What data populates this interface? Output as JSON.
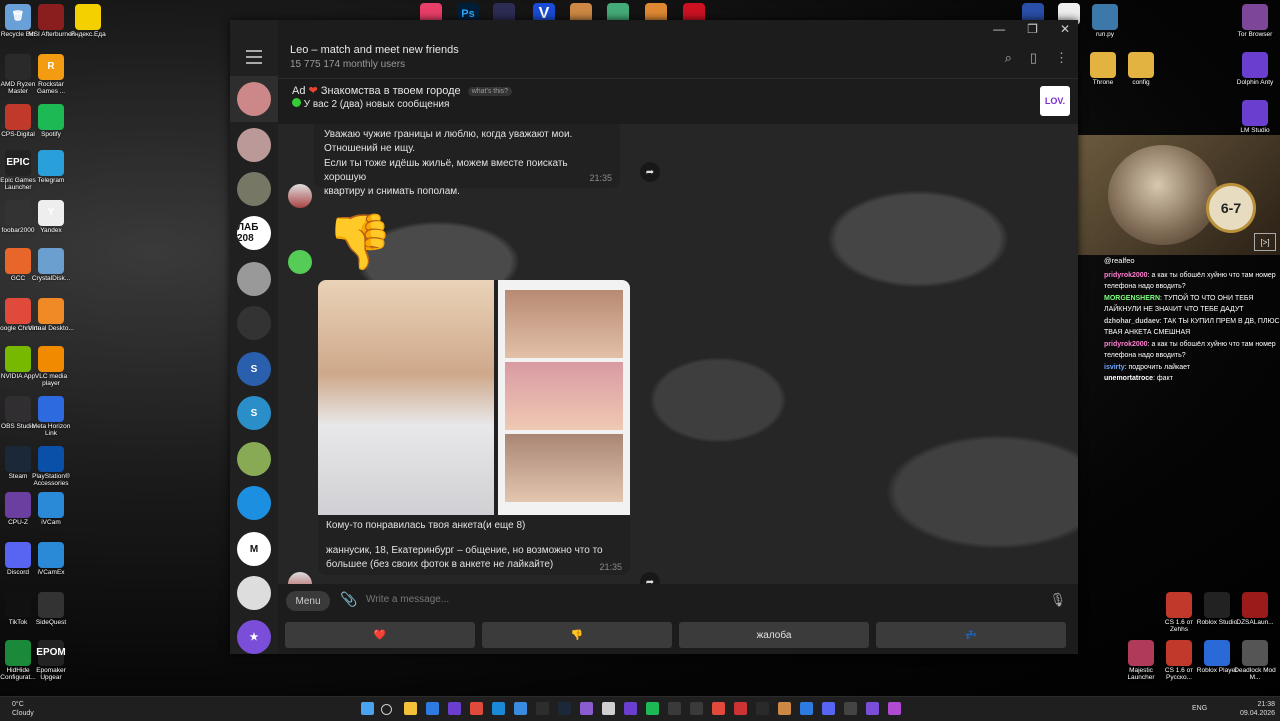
{
  "desktop": {
    "left_icons": [
      {
        "label": "Recycle Bin",
        "color": "#6aa0d8",
        "glyph": "🗑"
      },
      {
        "label": "MSI Afterburner",
        "color": "#8a1d1d",
        "glyph": ""
      },
      {
        "label": "Яндекс.Еда",
        "color": "#f5d000",
        "glyph": ""
      },
      {
        "label": "AMD Ryzen Master",
        "color": "#2a2a2a",
        "glyph": ""
      },
      {
        "label": "Rockstar Games ...",
        "color": "#f39c12",
        "glyph": "R"
      },
      {
        "label": "CPS-Digital",
        "color": "#c0392b",
        "glyph": ""
      },
      {
        "label": "Spotify",
        "color": "#1db954",
        "glyph": ""
      },
      {
        "label": "Epic Games Launcher",
        "color": "#222",
        "glyph": "EPIC"
      },
      {
        "label": "Telegram",
        "color": "#2aa0da",
        "glyph": ""
      },
      {
        "label": "foobar2000",
        "color": "#333",
        "glyph": ""
      },
      {
        "label": "Yandex",
        "color": "#eee",
        "glyph": "Y"
      },
      {
        "label": "GCC",
        "color": "#e8662a",
        "glyph": ""
      },
      {
        "label": "CrystalDisk...",
        "color": "#6a9fd0",
        "glyph": ""
      },
      {
        "label": "Google Chrome",
        "color": "#e04a3a",
        "glyph": ""
      },
      {
        "label": "Virtual Deskto...",
        "color": "#f08a24",
        "glyph": ""
      },
      {
        "label": "NVIDIA App",
        "color": "#76b900",
        "glyph": ""
      },
      {
        "label": "VLC media player",
        "color": "#f28a00",
        "glyph": ""
      },
      {
        "label": "OBS Studio",
        "color": "#302e31",
        "glyph": ""
      },
      {
        "label": "Meta Horizon Link",
        "color": "#2d6ae0",
        "glyph": ""
      },
      {
        "label": "Steam",
        "color": "#1b2838",
        "glyph": ""
      },
      {
        "label": "PlayStation® Accessories",
        "color": "#0a4fa8",
        "glyph": ""
      },
      {
        "label": "CPU-Z",
        "color": "#6b3fa0",
        "glyph": ""
      },
      {
        "label": "iVCam",
        "color": "#2a8ad8",
        "glyph": ""
      },
      {
        "label": "Discord",
        "color": "#5865f2",
        "glyph": ""
      },
      {
        "label": "iVCamEx",
        "color": "#2a8ad8",
        "glyph": ""
      },
      {
        "label": "TikTok",
        "color": "#111",
        "glyph": ""
      },
      {
        "label": "SideQuest",
        "color": "#333",
        "glyph": ""
      },
      {
        "label": "HidHide Configurat...",
        "color": "#1a8a3a",
        "glyph": ""
      },
      {
        "label": "Epomaker Upgear",
        "color": "#222",
        "glyph": "EPOM"
      }
    ],
    "right_icons": [
      {
        "label": "run.py",
        "color": "#3c78aa"
      },
      {
        "label": "Tor Browser",
        "color": "#7d4698"
      },
      {
        "label": "Throne",
        "color": "#e3b341"
      },
      {
        "label": "config",
        "color": "#e3b341"
      },
      {
        "label": "Dolphin Anty",
        "color": "#6a3fd0"
      },
      {
        "label": "LM Studio",
        "color": "#6a3fd0"
      },
      {
        "label": "CS 1.6 от Zehhs",
        "color": "#c0392b"
      },
      {
        "label": "Roblox Studio",
        "color": "#222"
      },
      {
        "label": "DZSALaun...",
        "color": "#9b1b1b"
      },
      {
        "label": "Majestic Launcher",
        "color": "#b03a5a"
      },
      {
        "label": "CS 1.6 от Русско...",
        "color": "#c0392b"
      },
      {
        "label": "Roblox Player",
        "color": "#2a6ad8"
      },
      {
        "label": "Deadlock Mod M...",
        "color": "#555"
      }
    ]
  },
  "telegram": {
    "bot_title": "Leo – match and meet new friends",
    "bot_subtitle": "15 775 174 monthly users",
    "ad": {
      "label": "Ad",
      "title": "Знакомства в твоем городе",
      "whats_this": "what's this?",
      "text": "У вас 2 (два) новых сообщения",
      "logo_text": "LOV."
    },
    "messages": [
      {
        "lines": [
          "Уважаю чужие границы и люблю, когда уважают мои.",
          "Отношений не ищу.",
          "Если ты тоже идёшь жильё, можем вместе поискать хорошую",
          "квартиру и снимать пополам."
        ],
        "time": "21:35"
      }
    ],
    "sticker": "👎",
    "photo_caption": {
      "line1": "Кому-то понравилась твоя анкета(и еще 8)",
      "line2": "жаннусик, 18, Екатеринбург – общение, но возможно что то",
      "line3": "большее (без своих фоток в анкете не лайкайте)",
      "time": "21:35"
    },
    "input": {
      "menu_label": "Menu",
      "placeholder": "Write a message..."
    },
    "keyboard": [
      {
        "label": "❤️"
      },
      {
        "label": "👎"
      },
      {
        "label": "жалоба"
      },
      {
        "label": "💤"
      }
    ],
    "chat_list": [
      {
        "text": "",
        "color": "#c88"
      },
      {
        "text": "",
        "color": "#b99"
      },
      {
        "text": "",
        "color": "#776"
      },
      {
        "text": "ЛАБ 208",
        "color": "#fff"
      },
      {
        "text": "",
        "color": "#999"
      },
      {
        "text": "",
        "color": "#333"
      },
      {
        "text": "S",
        "color": "#2a5fae"
      },
      {
        "text": "S",
        "color": "#2a8fc8"
      },
      {
        "text": "",
        "color": "#8a5"
      },
      {
        "text": "",
        "color": "#1d8fe0"
      },
      {
        "text": "M",
        "color": "#fff"
      },
      {
        "text": "",
        "color": "#ddd"
      },
      {
        "text": "★",
        "color": "#7a4ed8"
      }
    ]
  },
  "stream": {
    "streamer": "@realfeo",
    "chat": [
      {
        "name": "pridyrok2000",
        "color": "#ff7fd0",
        "text": "а как ты обошёл хуйню что там номер телефона надо вводить?"
      },
      {
        "name": "MORGENSHERN",
        "color": "#7fff7f",
        "text": "ТУПОЙ ТО ЧТО ОНИ ТЕБЯ ЛАЙКНУЛИ НЕ ЗНАЧИТ ЧТО ТЕБЕ ДАДУТ"
      },
      {
        "name": "dzhohar_dudaev",
        "color": "#cfcfcf",
        "text": "ТАК ТЫ КУПИЛ ПРЕМ В ДВ, ПЛЮС ТВАЯ АНКЕТА СМЕШНАЯ"
      },
      {
        "name": "pridyrok2000",
        "color": "#ff7fd0",
        "text": "а как ты обошёл хуйню что там номер телефона надо вводить?"
      },
      {
        "name": "isvirty",
        "color": "#6fa8ff",
        "text": "подрочить лайкает"
      },
      {
        "name": "unemortatroce",
        "color": "#ffffff",
        "text": "факт"
      }
    ]
  },
  "taskbar": {
    "weather_temp": "0°C",
    "weather_text": "Cloudy",
    "lang": "ENG",
    "time": "21:38",
    "date": "09.04.2026"
  }
}
